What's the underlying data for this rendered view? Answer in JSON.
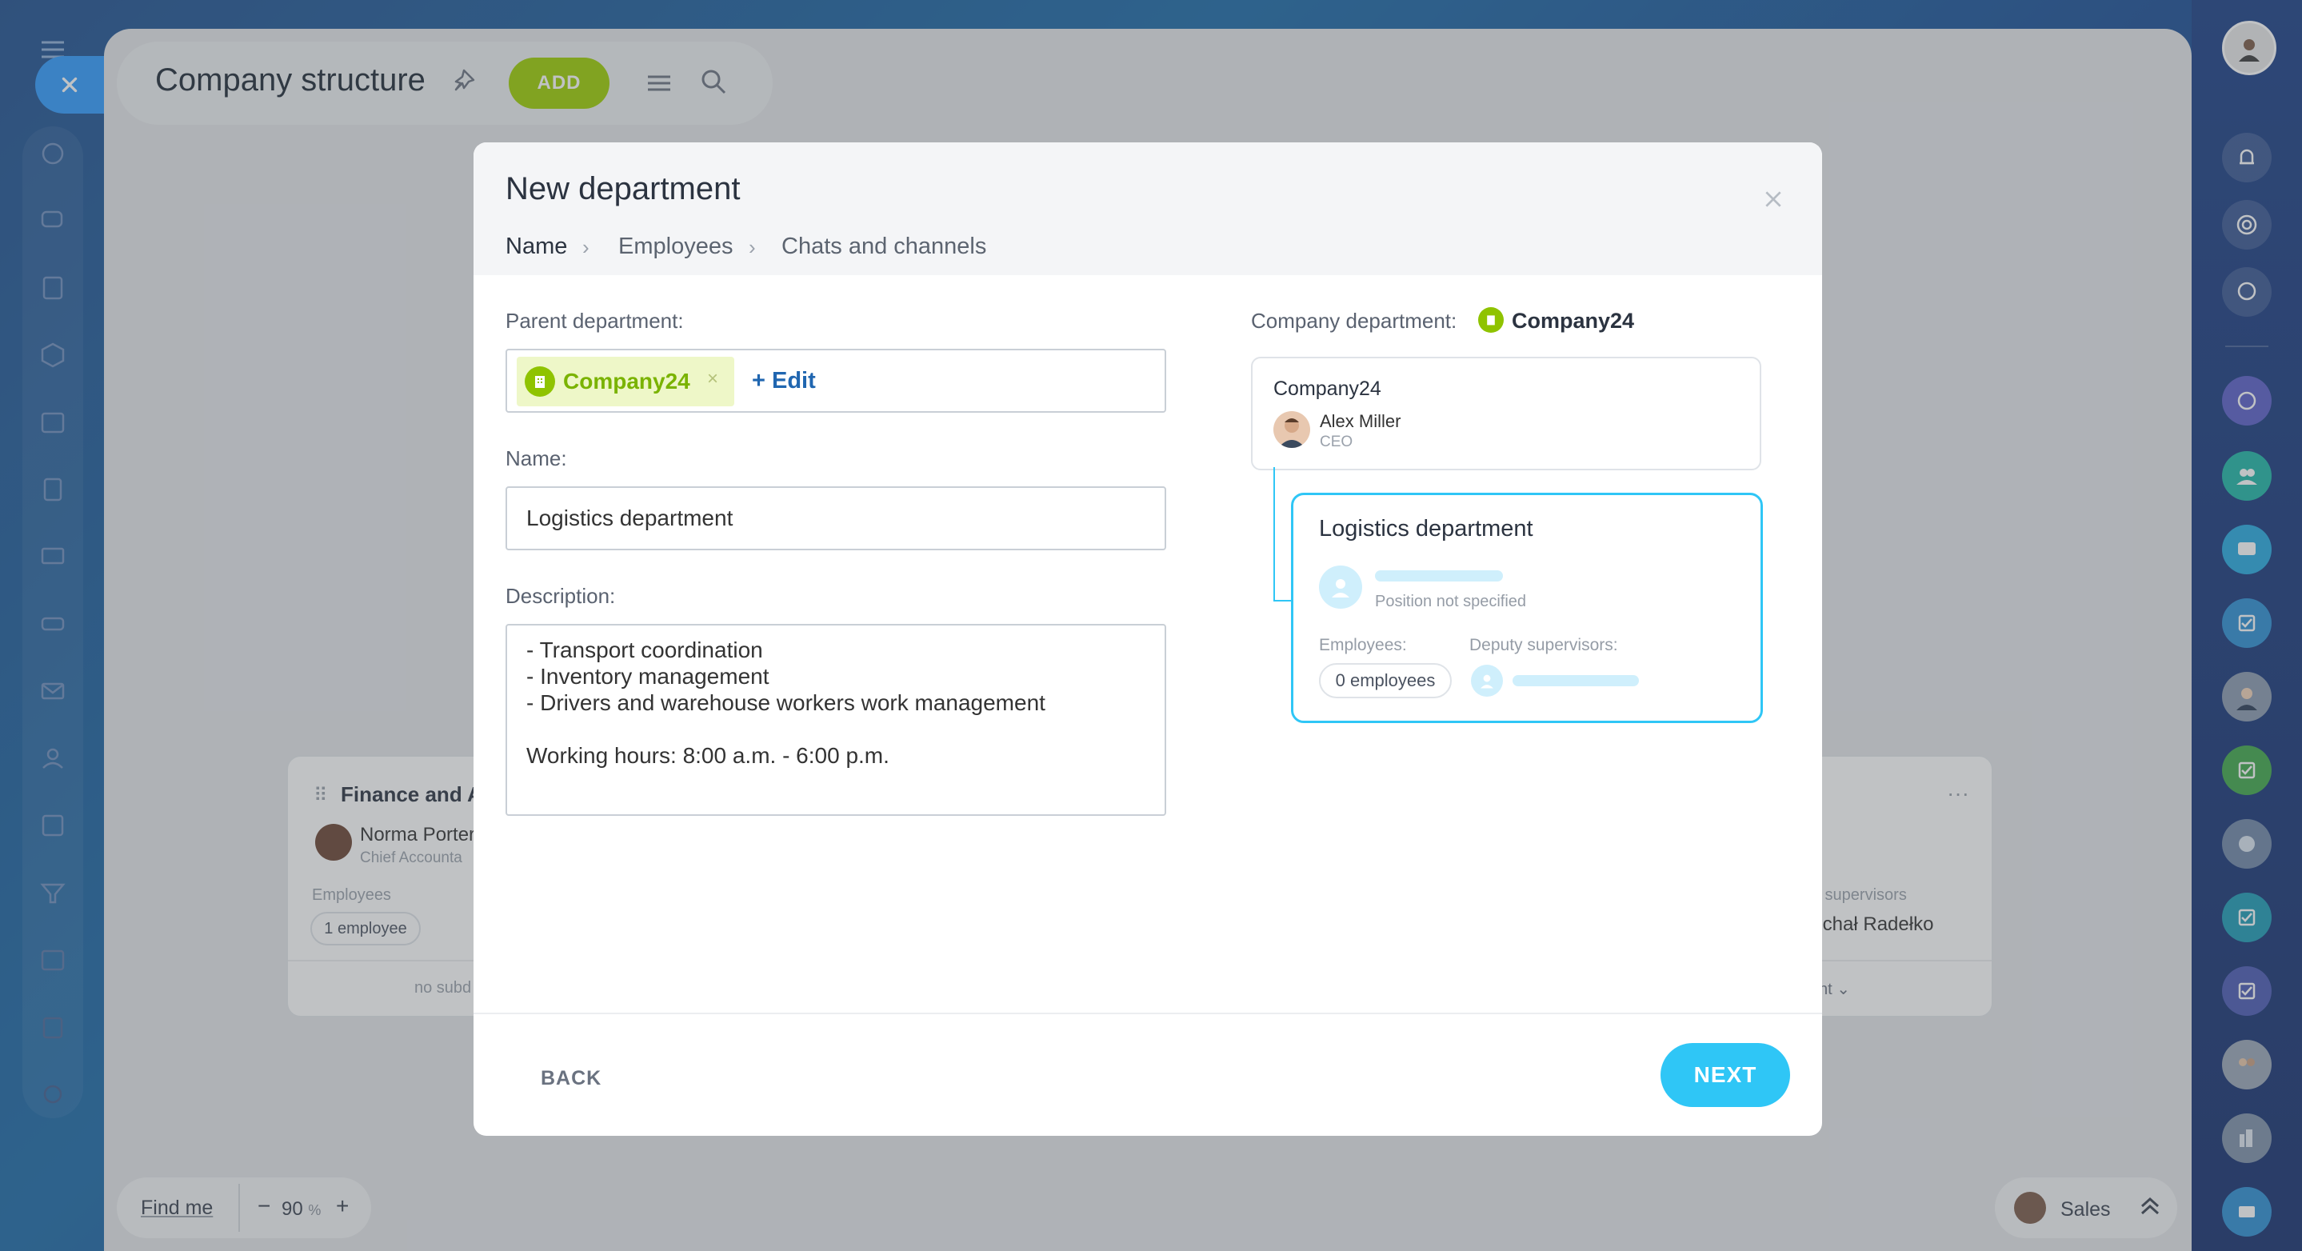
{
  "app": {
    "page_title": "Company structure",
    "add_label": "ADD"
  },
  "bottom": {
    "find_me": "Find me",
    "zoom_minus": "−",
    "zoom_value": "90",
    "zoom_unit": "%",
    "zoom_plus": "+",
    "sales_label": "Sales"
  },
  "background_cards": {
    "left": {
      "title": "Finance and A",
      "head_name": "Norma Porter",
      "head_position": "Chief Accounta",
      "employees_label": "Employees",
      "employees_value": "1 employee",
      "footer": "no subd"
    },
    "right": {
      "deputy_label": "y supervisors",
      "deputy_name": "lichał Radełko",
      "footer": "nt"
    }
  },
  "modal": {
    "title": "New department",
    "steps": [
      "Name",
      "Employees",
      "Chats and channels"
    ],
    "parent_label": "Parent department:",
    "parent_tag": "Company24",
    "edit_label": "+ Edit",
    "name_label": "Name:",
    "name_value": "Logistics department",
    "description_label": "Description:",
    "description_lines": [
      "- Transport coordination",
      "- Inventory management",
      "- Drivers and warehouse workers work management",
      "",
      "Working hours: 8:00 a.m. - 6:00 p.m."
    ],
    "back_label": "BACK",
    "next_label": "NEXT"
  },
  "preview": {
    "company_label": "Company department:",
    "company_name": "Company24",
    "parent_card": {
      "title": "Company24",
      "head_name": "Alex Miller",
      "head_position": "CEO"
    },
    "dept_card": {
      "title": "Logistics department",
      "position_placeholder": "Position not specified",
      "employees_label": "Employees:",
      "employees_value": "0 employees",
      "deputy_label": "Deputy supervisors:"
    }
  },
  "colors": {
    "accent_blue": "#2fc6f6",
    "add_green": "#9dcf00",
    "tag_green": "#7ab300",
    "edit_blue": "#2066b0"
  }
}
